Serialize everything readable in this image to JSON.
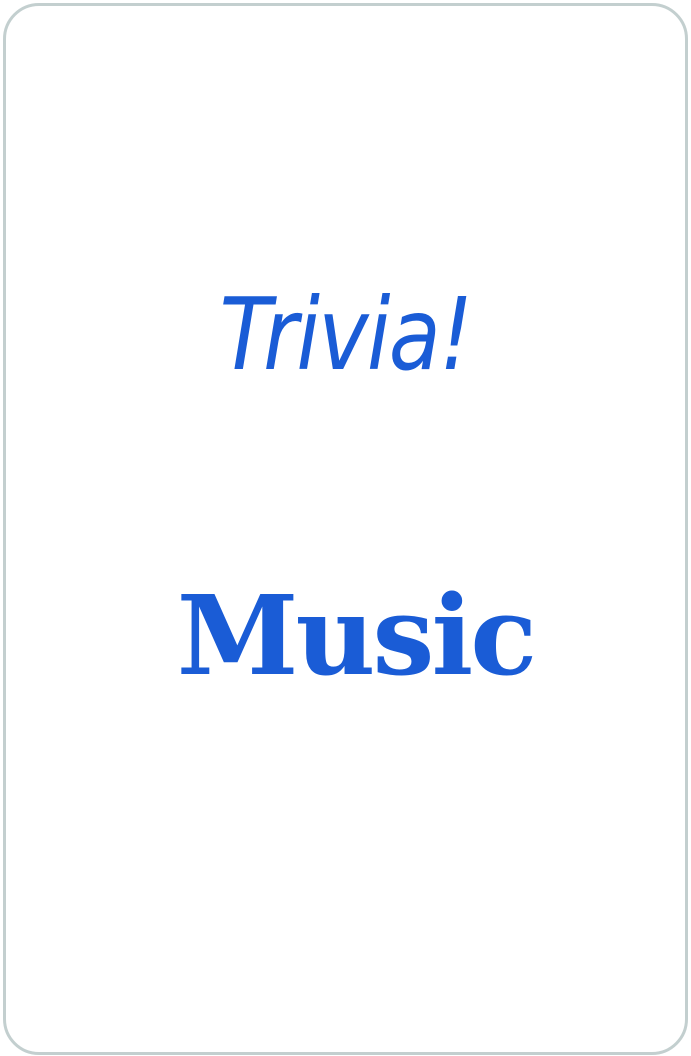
{
  "card": {
    "title": "Trivia!",
    "category": "Music",
    "colors": {
      "text": "#1a5cd6",
      "border": "#c3cfcf",
      "background": "#ffffff"
    }
  }
}
